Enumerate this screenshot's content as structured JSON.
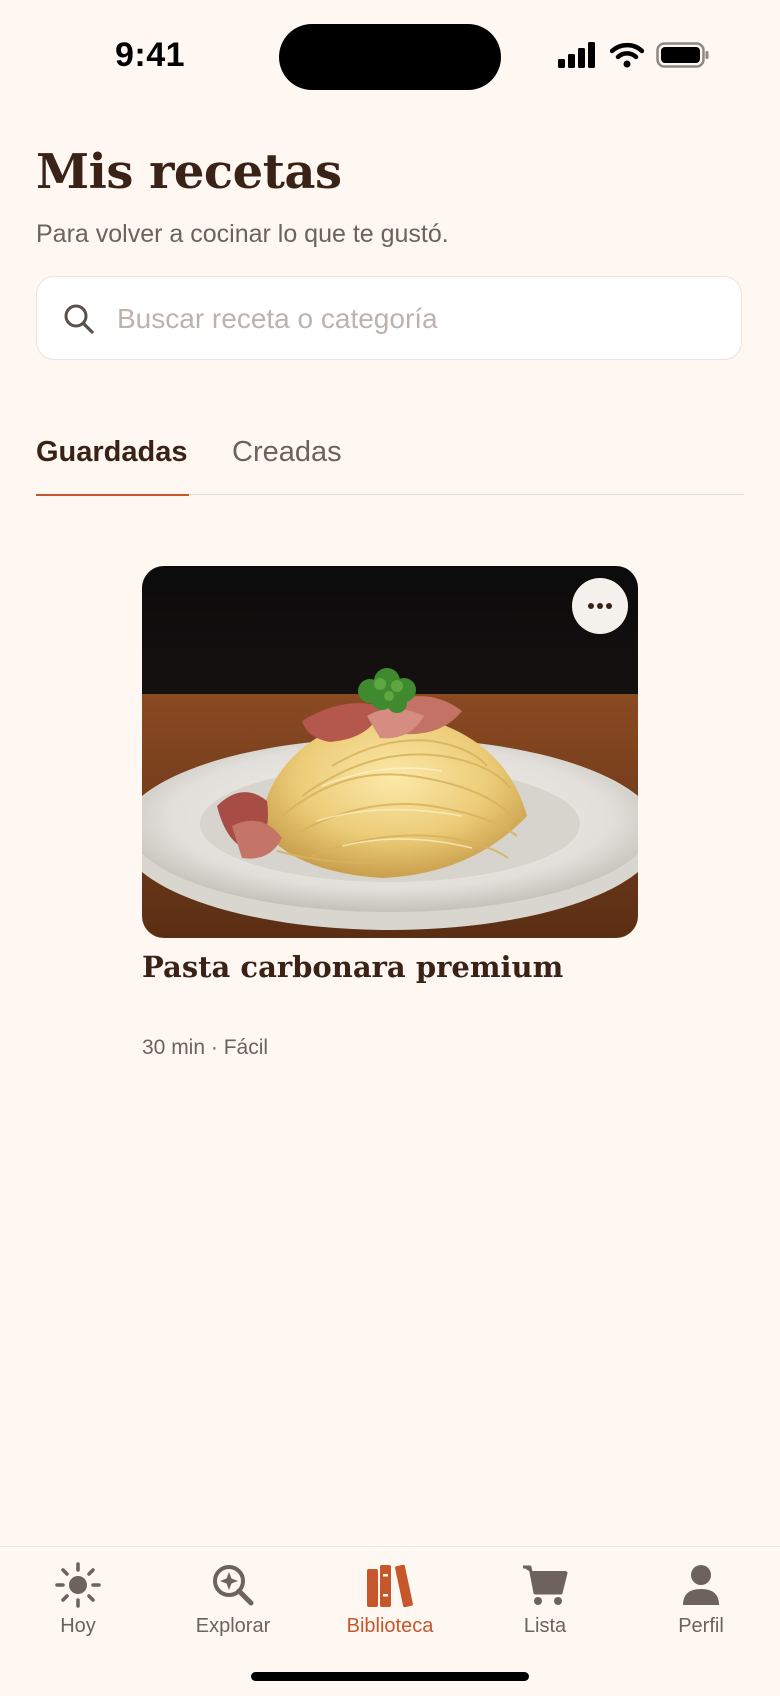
{
  "status_bar": {
    "time": "9:41"
  },
  "header": {
    "title": "Mis recetas",
    "subtitle": "Para volver a cocinar lo que te gustó."
  },
  "search": {
    "placeholder": "Buscar receta o categoría",
    "value": ""
  },
  "tabs": [
    {
      "label": "Guardadas",
      "active": true
    },
    {
      "label": "Creadas",
      "active": false
    }
  ],
  "recipes": [
    {
      "title": "Pasta carbonara premium",
      "meta": "30 min · Fácil"
    }
  ],
  "tab_bar": {
    "items": [
      {
        "label": "Hoy",
        "icon": "sun-icon",
        "active": false
      },
      {
        "label": "Explorar",
        "icon": "explore-search-icon",
        "active": false
      },
      {
        "label": "Biblioteca",
        "icon": "library-books-icon",
        "active": true
      },
      {
        "label": "Lista",
        "icon": "cart-icon",
        "active": false
      },
      {
        "label": "Perfil",
        "icon": "person-icon",
        "active": false
      }
    ]
  },
  "colors": {
    "accent": "#C6572A",
    "background": "#FEF7F2",
    "text_dark": "#3B2216",
    "text_muted": "#6E625C"
  }
}
